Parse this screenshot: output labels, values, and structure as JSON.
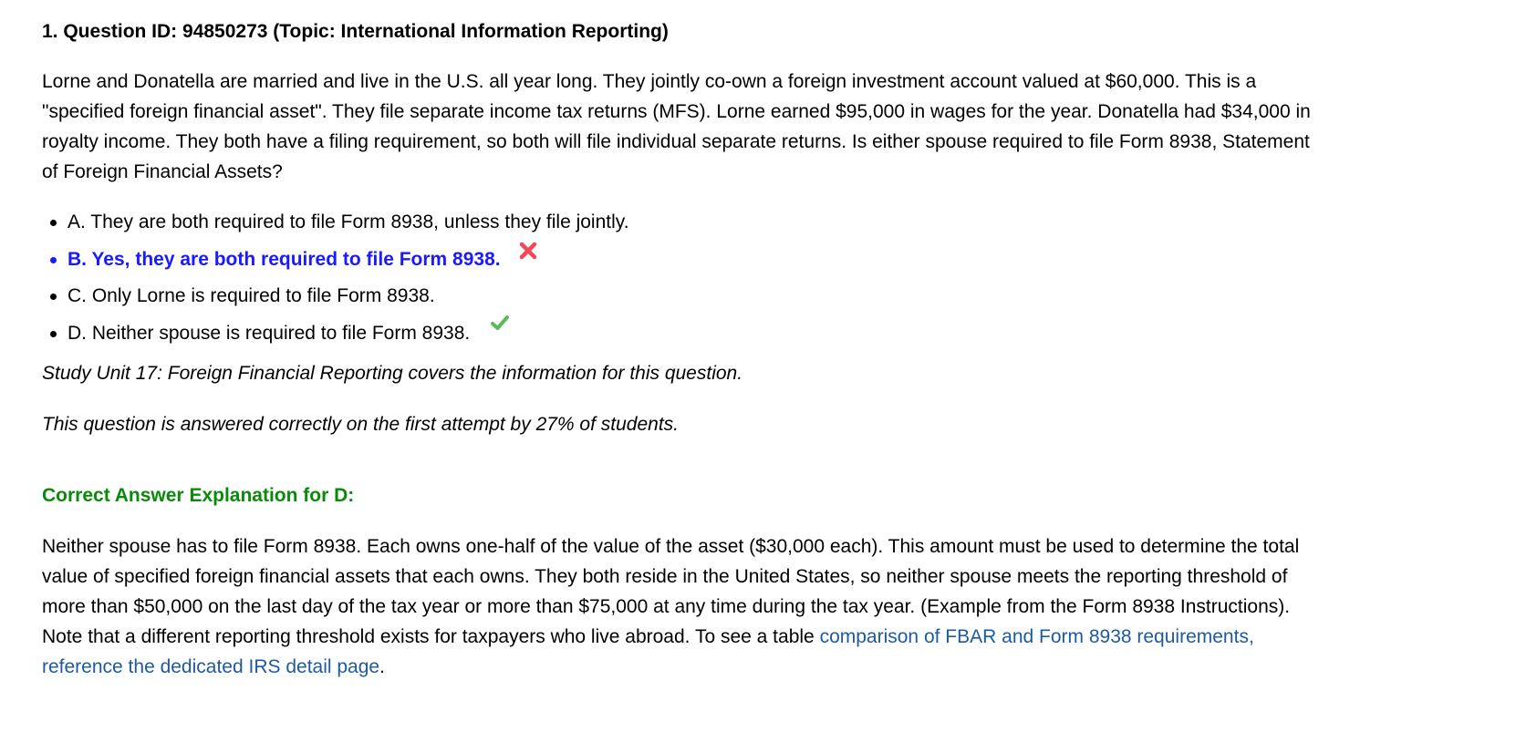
{
  "question": {
    "title": "1. Question ID: 94850273 (Topic: International Information Reporting)",
    "text": "Lorne and Donatella are married and live in the U.S. all year long. They jointly co-own a foreign investment account valued at $60,000. This is a \"specified foreign financial asset\". They file separate income tax returns (MFS). Lorne earned $95,000 in wages for the year. Donatella had $34,000 in royalty income. They both have a filing requirement, so both will file individual separate returns. Is either spouse required to file Form 8938, Statement of Foreign Financial Assets?",
    "choices": [
      {
        "label": "A. They are both required to file Form 8938, unless they file jointly.",
        "selected": false,
        "mark": ""
      },
      {
        "label": "B. Yes, they are both required to file Form 8938.",
        "selected": true,
        "mark": "wrong-x-icon"
      },
      {
        "label": "C. Only Lorne is required to file Form 8938.",
        "selected": false,
        "mark": ""
      },
      {
        "label": "D. Neither spouse is required to file Form 8938.",
        "selected": false,
        "mark": "correct-check-icon"
      }
    ]
  },
  "study_unit": "Study Unit 17: Foreign Financial Reporting covers the information for this question.",
  "stat_line": "This question is answered correctly on the first attempt by 27% of students.",
  "explanation": {
    "title": "Correct Answer Explanation for D:",
    "text": "Neither spouse has to file Form 8938. Each owns one-half of the value of the asset ($30,000 each). This amount must be used to determine the total value of specified foreign financial assets that each owns. They both reside in the United States, so neither spouse meets the reporting threshold of more than $50,000 on the last day of the tax year or more than $75,000 at any time during the tax year. (Example from the Form 8938 Instructions). Note that a different reporting threshold exists for taxpayers who live abroad. To see a table ",
    "link_text": "comparison of FBAR and Form 8938 requirements,  reference the dedicated IRS detail page",
    "trailing": "."
  },
  "colors": {
    "selected_answer": "#1a1aff",
    "explanation_title": "#0a8a0a",
    "link": "#1d5a9e",
    "wrong_mark": "#f04a5a",
    "correct_mark": "#5cb85c"
  }
}
